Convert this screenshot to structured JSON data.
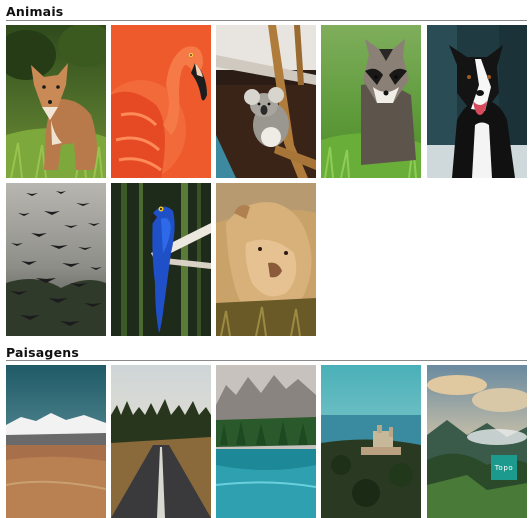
{
  "sections": [
    {
      "title": "Animais"
    },
    {
      "title": "Paisagens"
    }
  ],
  "back_to_top": {
    "label": "Topo"
  },
  "colors": {
    "accent": "#1c9a8e",
    "rule": "#8a8a8a",
    "heading": "#111111"
  }
}
